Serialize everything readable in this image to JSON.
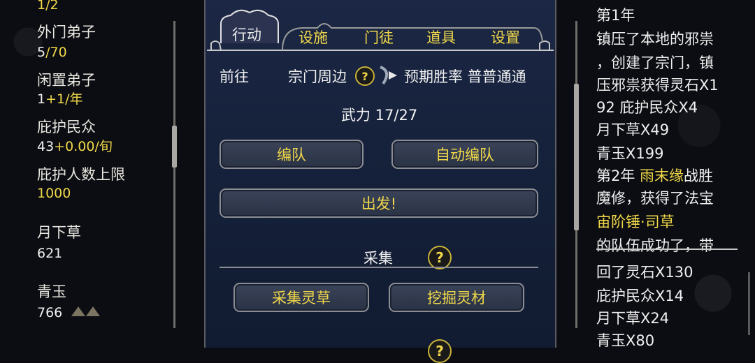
{
  "left_stats": {
    "top_partial": "1/2",
    "outer_disciples": {
      "label": "外门弟子",
      "value_a": "5",
      "value_b": "/70"
    },
    "idle_disciples": {
      "label": "闲置弟子",
      "value_a": "1",
      "value_b": "+1/年"
    },
    "protected_people": {
      "label": "庇护民众",
      "value_a": "43",
      "value_b": "+0.00/旬"
    },
    "protect_limit": {
      "label": "庇护人数上限",
      "value": "1000"
    },
    "moon_grass": {
      "label": "月下草",
      "value": "621"
    },
    "jade": {
      "label": "青玉",
      "value": "766"
    }
  },
  "tabs": {
    "active": "行动",
    "facilities": "设施",
    "disciples": "门徒",
    "items": "道具",
    "settings": "设置"
  },
  "action": {
    "goto_label": "前往",
    "destination": "宗门周边",
    "expected_win_rate": "预期胜率 普普通通",
    "force": "武力 17/27",
    "formation_button": "编队",
    "auto_formation_button": "自动编队",
    "depart_button": "出发!",
    "gather_title": "采集",
    "gather_herbs_button": "采集灵草",
    "dig_materials_button": "挖掘灵材",
    "question_mark": "?"
  },
  "log": {
    "lines": [
      {
        "parts": [
          {
            "t": "第1年",
            "c": "w"
          }
        ]
      },
      {
        "parts": [
          {
            "t": "镇压了本地的邪祟",
            "c": "w"
          }
        ]
      },
      {
        "parts": [
          {
            "t": "，创建了宗门，镇",
            "c": "w"
          }
        ]
      },
      {
        "parts": [
          {
            "t": "压邪祟获得灵石X1",
            "c": "w"
          }
        ]
      },
      {
        "parts": [
          {
            "t": "92 庇护民众X4",
            "c": "w"
          }
        ]
      },
      {
        "parts": [
          {
            "t": "月下草X49",
            "c": "w"
          }
        ]
      },
      {
        "parts": [
          {
            "t": "青玉X199",
            "c": "w"
          }
        ]
      },
      {
        "parts": [
          {
            "t": "第2年 ",
            "c": "w"
          },
          {
            "t": "雨末缘",
            "c": "y"
          },
          {
            "t": "战胜",
            "c": "w"
          }
        ]
      },
      {
        "parts": [
          {
            "t": "魔修，获得了法宝",
            "c": "w"
          }
        ]
      },
      {
        "parts": [
          {
            "t": "宙阶锤·司草",
            "c": "y"
          }
        ]
      },
      {
        "parts": [
          {
            "t": "的队伍成功了，带",
            "c": "w"
          }
        ]
      },
      {
        "parts": [
          {
            "t": "回了灵石X130",
            "c": "w"
          }
        ]
      },
      {
        "parts": [
          {
            "t": "庇护民众X14",
            "c": "w"
          }
        ]
      },
      {
        "parts": [
          {
            "t": "月下草X24",
            "c": "w"
          }
        ]
      },
      {
        "parts": [
          {
            "t": "青玉X80",
            "c": "w"
          }
        ]
      }
    ]
  },
  "colors": {
    "accent_yellow": "#f1d84a",
    "panel_blue": "#1b2744",
    "text_white": "#f0f0f0"
  }
}
